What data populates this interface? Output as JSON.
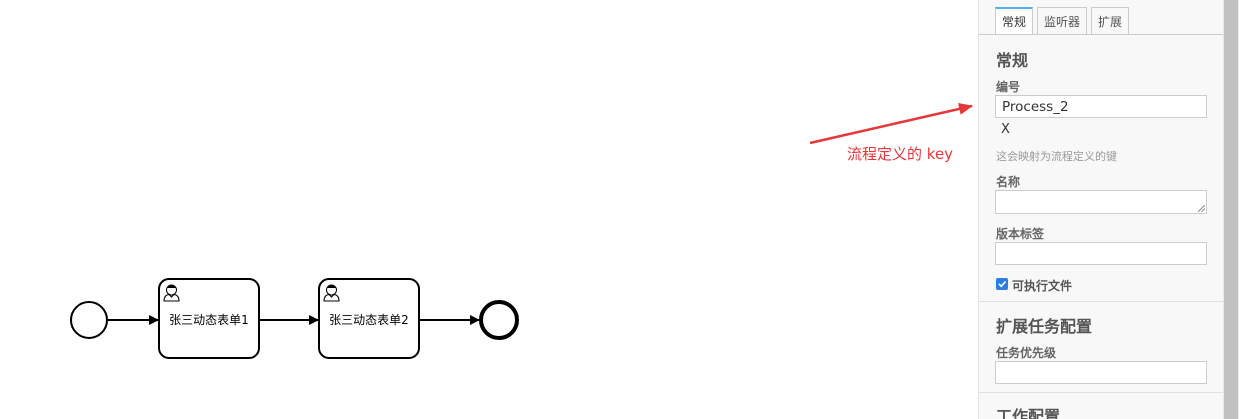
{
  "canvas": {
    "tasks": [
      {
        "label": "张三动态表单1"
      },
      {
        "label": "张三动态表单2"
      }
    ],
    "annotation": "流程定义的 key",
    "annotation_color": "#e5383b"
  },
  "panel": {
    "tabs": [
      {
        "label": "常规",
        "active": true
      },
      {
        "label": "监听器",
        "active": false
      },
      {
        "label": "扩展",
        "active": false
      }
    ],
    "general": {
      "title": "常规",
      "id_label": "编号",
      "id_value": "Process_2",
      "clear_label": "X",
      "id_hint": "这会映射为流程定义的键",
      "name_label": "名称",
      "name_value": "",
      "version_label": "版本标签",
      "version_value": "",
      "executable_label": "可执行文件",
      "executable_checked": true
    },
    "extension": {
      "title": "扩展任务配置",
      "priority_label": "任务优先级",
      "priority_value": ""
    },
    "job": {
      "title": "工作配置"
    },
    "accent_color": "#52b4e8"
  }
}
